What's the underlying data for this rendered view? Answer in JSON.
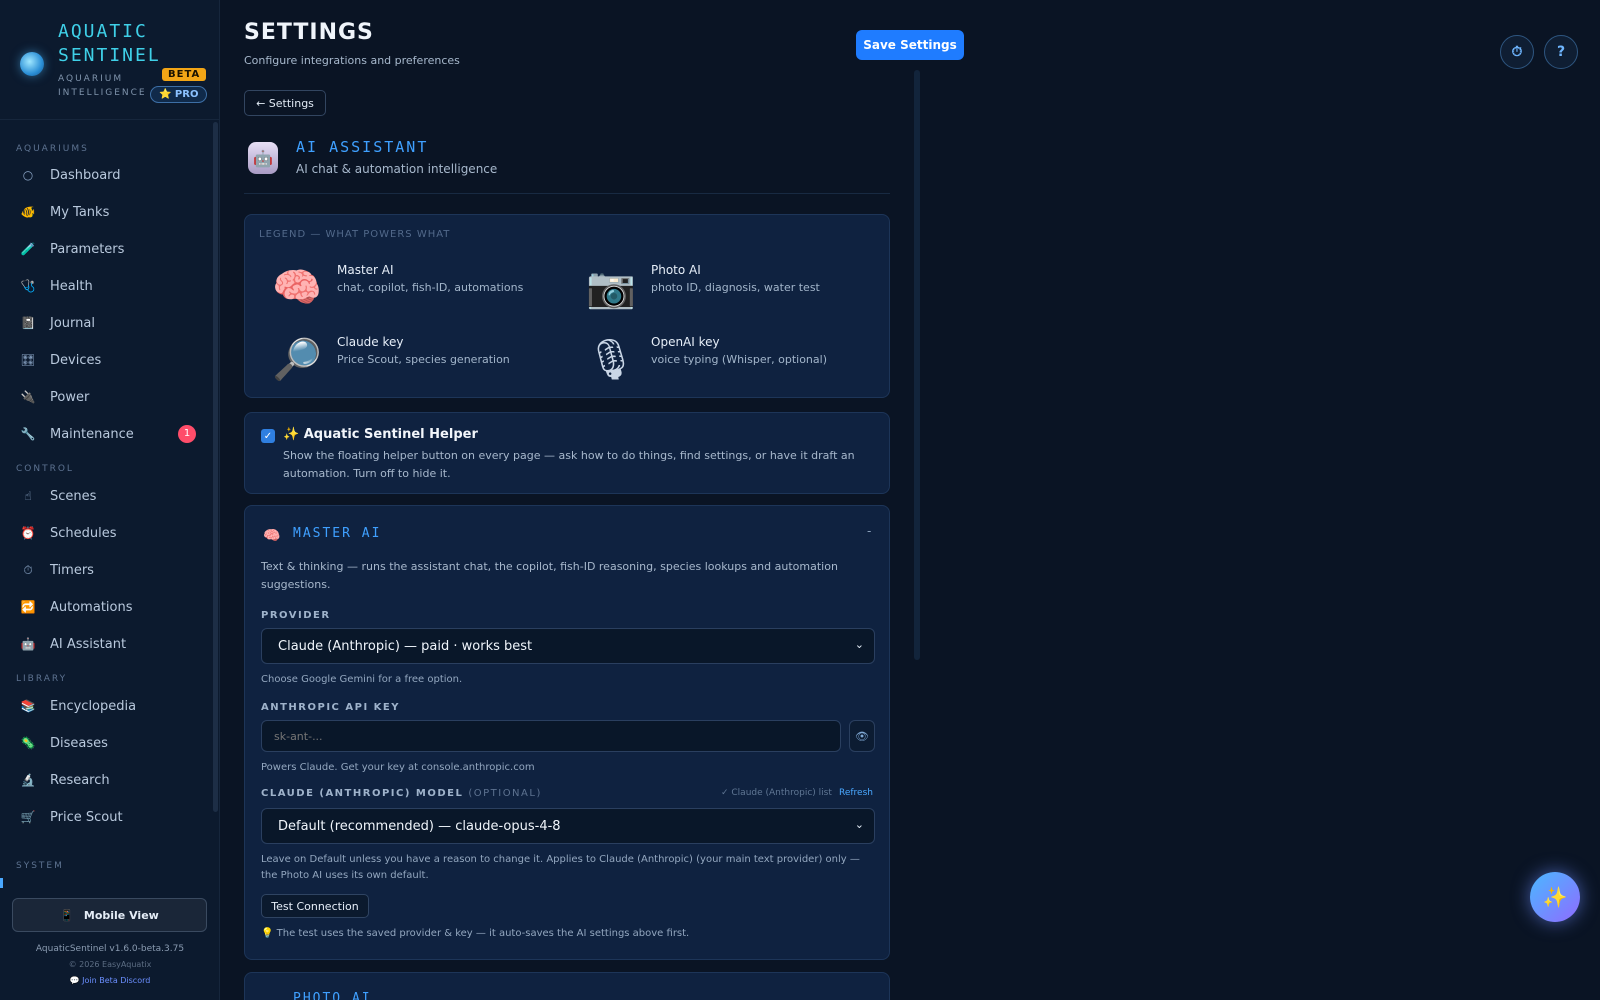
{
  "brand": {
    "title_line1": "AQUATIC",
    "title_line2": "SENTINEL",
    "sub_line1": "AQUARIUM",
    "sub_line2": "INTELLIGENCE",
    "beta": "BETA",
    "pro": "⭐ PRO"
  },
  "sidebar": {
    "sections": {
      "aquariums": "AQUARIUMS",
      "control": "CONTROL",
      "library": "LIBRARY",
      "system": "SYSTEM"
    },
    "items": [
      {
        "label": "Dashboard",
        "icon": "○"
      },
      {
        "label": "My Tanks",
        "icon": "🐠"
      },
      {
        "label": "Parameters",
        "icon": "🧪"
      },
      {
        "label": "Health",
        "icon": "🩺"
      },
      {
        "label": "Journal",
        "icon": "📓"
      },
      {
        "label": "Devices",
        "icon": "🎛"
      },
      {
        "label": "Power",
        "icon": "🔌"
      },
      {
        "label": "Maintenance",
        "icon": "🔧",
        "badge": "1"
      },
      {
        "label": "Scenes",
        "icon": "☝"
      },
      {
        "label": "Schedules",
        "icon": "⏰"
      },
      {
        "label": "Timers",
        "icon": "⏱"
      },
      {
        "label": "Automations",
        "icon": "🔁"
      },
      {
        "label": "AI Assistant",
        "icon": "🤖"
      },
      {
        "label": "Encyclopedia",
        "icon": "📚"
      },
      {
        "label": "Diseases",
        "icon": "🦠"
      },
      {
        "label": "Research",
        "icon": "🔬"
      },
      {
        "label": "Price Scout",
        "icon": "🛒"
      }
    ],
    "mobile_view": "Mobile View",
    "version": "AquaticSentinel v1.6.0-beta.3.75",
    "copyright": "© 2026 EasyAquatix",
    "discord": "💬 Join Beta Discord"
  },
  "header": {
    "title": "SETTINGS",
    "subtitle": "Configure integrations and preferences",
    "save": "Save Settings",
    "back": "← Settings"
  },
  "section": {
    "title": "AI ASSISTANT",
    "desc": "AI chat & automation intelligence"
  },
  "legend": {
    "label": "LEGEND — WHAT POWERS WHAT",
    "items": [
      {
        "name": "Master AI",
        "desc": "chat, copilot, fish-ID, automations",
        "icon": "🧠"
      },
      {
        "name": "Photo AI",
        "desc": "photo ID, diagnosis, water test",
        "icon": "📷"
      },
      {
        "name": "Claude key",
        "desc": "Price Scout, species generation",
        "icon": "🔎"
      },
      {
        "name": "OpenAI key",
        "desc": "voice typing (Whisper, optional)",
        "icon": "🎙"
      }
    ]
  },
  "helper": {
    "checked": true,
    "title": "✨ Aquatic Sentinel Helper",
    "desc": "Show the floating helper button on every page — ask how to do things, find settings, or have it draft an automation. Turn off to hide it."
  },
  "master_ai": {
    "title": "MASTER AI",
    "collapse": "-",
    "desc": "Text & thinking — runs the assistant chat, the copilot, fish-ID reasoning, species lookups and automation suggestions.",
    "provider_label": "PROVIDER",
    "provider_value": "Claude (Anthropic) — paid · works best",
    "provider_hint": "Choose Google Gemini for a free option.",
    "api_key_label": "ANTHROPIC API KEY",
    "api_key_placeholder": "sk-ant-...",
    "api_key_hint": "Powers Claude. Get your key at console.anthropic.com",
    "model_label": "CLAUDE (ANTHROPIC) MODEL",
    "model_optional": "(OPTIONAL)",
    "model_list_status": "✓ Claude (Anthropic) list",
    "refresh": "Refresh",
    "model_value": "Default (recommended) — claude-opus-4-8",
    "model_hint": "Leave on Default unless you have a reason to change it. Applies to Claude (Anthropic) (your main text provider) only — the Photo AI uses its own default.",
    "test_button": "Test Connection",
    "test_note": "💡 The test uses the saved provider & key — it auto-saves the AI settings above first."
  },
  "photo_ai_peek": "PHOTO AI",
  "top_icons": {
    "timer": "⏱",
    "help": "?"
  },
  "fab": "✨"
}
